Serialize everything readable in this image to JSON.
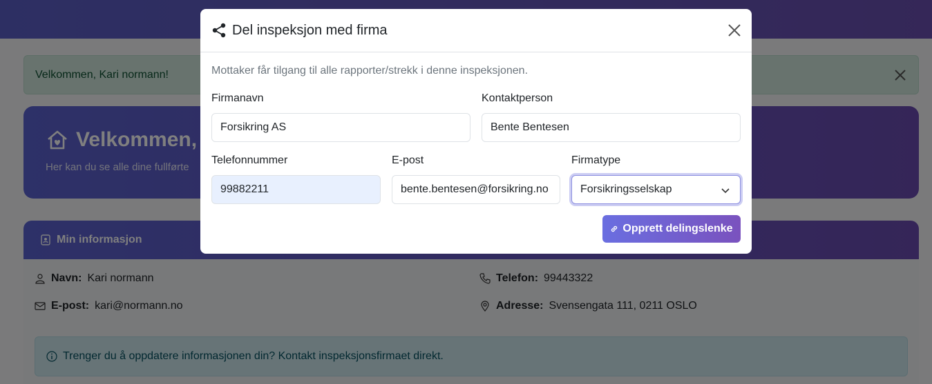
{
  "background": {
    "welcome_alert": "Velkommen, Kari normann!",
    "hero_title": "Velkommen,",
    "hero_subtitle": "Her kan du se alle dine fullførte",
    "info_card": {
      "title": "Min informasjon",
      "name_label": "Navn:",
      "name_value": "Kari normann",
      "email_label": "E-post:",
      "email_value": "kari@normann.no",
      "phone_label": "Telefon:",
      "phone_value": "99443322",
      "address_label": "Adresse:",
      "address_value": "Svensengata 111, 0211 OSLO",
      "note": "Trenger du å oppdatere informasjonen din? Kontakt inspeksjonsfirmaet direkt."
    }
  },
  "modal": {
    "title": "Del inspeksjon med firma",
    "description": "Mottaker får tilgang til alle rapporter/strekk i denne inspeksjonen.",
    "fields": {
      "company_name": {
        "label": "Firmanavn",
        "value": "Forsikring AS"
      },
      "contact_person": {
        "label": "Kontaktperson",
        "value": "Bente Bentesen"
      },
      "phone": {
        "label": "Telefonnummer",
        "value": "99882211"
      },
      "email": {
        "label": "E-post",
        "value": "bente.bentesen@forsikring.no"
      },
      "company_type": {
        "label": "Firmatype",
        "value": "Forsikringsselskap"
      }
    },
    "submit_label": "Opprett delingslenke"
  },
  "colors": {
    "brand_start": "#5b62d0",
    "brand_end": "#6a4bb0",
    "success_bg": "#d1e7dd",
    "info_bg": "#cfe9ef"
  }
}
